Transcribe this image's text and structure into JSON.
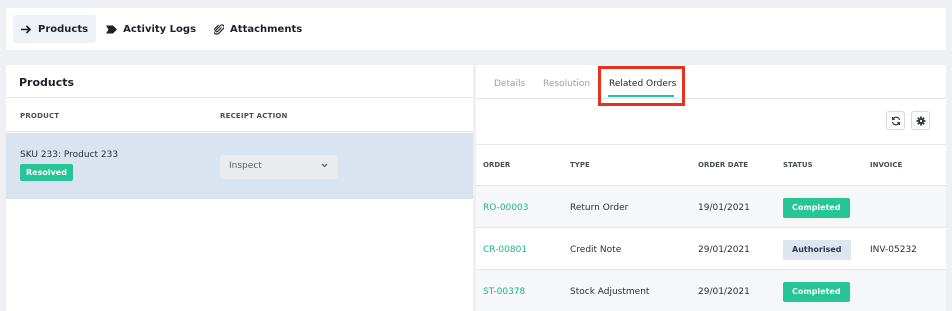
{
  "top_tabs": [
    {
      "label": "Products",
      "icon": "arrow-right-icon",
      "active": true
    },
    {
      "label": "Activity Logs",
      "icon": "tag-icon",
      "active": false
    },
    {
      "label": "Attachments",
      "icon": "paperclip-icon",
      "active": false
    }
  ],
  "products_panel": {
    "title": "Products",
    "columns": [
      "PRODUCT",
      "RECEIPT ACTION"
    ],
    "row": {
      "product": "SKU 233: Product 233",
      "status": "Resolved",
      "receipt_action": "Inspect"
    }
  },
  "detail_panel": {
    "tabs": [
      "Details",
      "Resolution",
      "Related Orders"
    ],
    "active_tab": "Related Orders",
    "toolbar_icons": [
      "refresh-icon",
      "gear-icon"
    ],
    "columns": [
      "ORDER",
      "TYPE",
      "ORDER DATE",
      "STATUS",
      "INVOICE"
    ],
    "rows": [
      {
        "order": "RO-00003",
        "type": "Return Order",
        "date": "19/01/2021",
        "status": "Completed",
        "invoice": ""
      },
      {
        "order": "CR-00801",
        "type": "Credit Note",
        "date": "29/01/2021",
        "status": "Authorised",
        "invoice": "INV-05232"
      },
      {
        "order": "ST-00378",
        "type": "Stock Adjustment",
        "date": "29/01/2021",
        "status": "Completed",
        "invoice": ""
      }
    ]
  },
  "colors": {
    "accent": "#27c496",
    "highlight": "#e8321f",
    "selected_row": "#dae4f0",
    "authorised_badge": "#dde5ef"
  }
}
